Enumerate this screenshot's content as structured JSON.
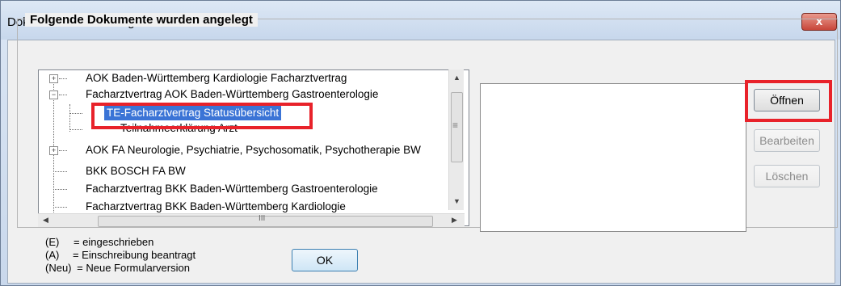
{
  "window": {
    "title": "Dokumentenverwaltung Arzt",
    "close_label": "x"
  },
  "group": {
    "title": "Folgende Dokumente wurden angelegt"
  },
  "tree": {
    "items": [
      {
        "label": "AOK Baden-Württemberg Kardiologie Facharztvertrag",
        "expander": "+"
      },
      {
        "label": "Facharztvertrag AOK Baden-Württemberg Gastroenterologie",
        "expander": "−"
      },
      {
        "label": "TE-Facharztvertrag Statusübersicht",
        "selected": true
      },
      {
        "label": "Teilnahmeerklärung Arzt"
      },
      {
        "label": "AOK FA Neurologie, Psychiatrie, Psychosomatik, Psychotherapie BW",
        "expander": "+"
      },
      {
        "label": "BKK BOSCH FA BW"
      },
      {
        "label": "Facharztvertrag BKK Baden-Württemberg Gastroenterologie"
      },
      {
        "label": "Facharztvertrag BKK Baden-Württemberg Kardiologie"
      }
    ],
    "scroll_grip": "≡",
    "hscroll_grip": "III"
  },
  "buttons": {
    "open": "Öffnen",
    "edit": "Bearbeiten",
    "delete": "Löschen",
    "ok": "OK"
  },
  "legend": [
    {
      "key": "(E)",
      "text": "= eingeschrieben"
    },
    {
      "key": "(A)",
      "text": "= Einschreibung beantragt"
    },
    {
      "key": "(Neu)",
      "text": "= Neue Formularversion"
    }
  ],
  "colors": {
    "selection": "#3b74d6",
    "highlight_box": "#e8222a"
  }
}
